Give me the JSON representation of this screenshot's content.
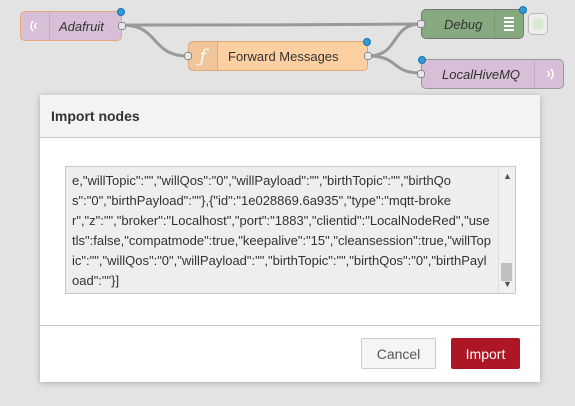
{
  "flow": {
    "nodes": {
      "adafruit": {
        "label": "Adafruit",
        "icon": "broadcast-icon"
      },
      "forward": {
        "label": "Forward Messages",
        "icon": "function-icon"
      },
      "debug": {
        "label": "Debug",
        "icon": "debug-list-icon"
      },
      "localhive": {
        "label": "LocalHiveMQ",
        "icon": "broadcast-icon"
      }
    }
  },
  "dialog": {
    "title": "Import nodes",
    "textarea_value": "e,\"willTopic\":\"\",\"willQos\":\"0\",\"willPayload\":\"\",\"birthTopic\":\"\",\"birthQos\":\"0\",\"birthPayload\":\"\"},{\"id\":\"1e028869.6a935\",\"type\":\"mqtt-broker\",\"z\":\"\",\"broker\":\"Localhost\",\"port\":\"1883\",\"clientid\":\"LocalNodeRed\",\"usetls\":false,\"compatmode\":true,\"keepalive\":\"15\",\"cleansession\":true,\"willTopic\":\"\",\"willQos\":\"0\",\"willPayload\":\"\",\"birthTopic\":\"\",\"birthQos\":\"0\",\"birthPayload\":\"\"}]",
    "cancel_label": "Cancel",
    "import_label": "Import"
  },
  "colors": {
    "import_button": "#ad1625",
    "status_dot": "#2f9bdc",
    "function_node": "#fdd0a2",
    "mqtt_node": "#d8bfd8",
    "debug_node": "#87a980"
  }
}
